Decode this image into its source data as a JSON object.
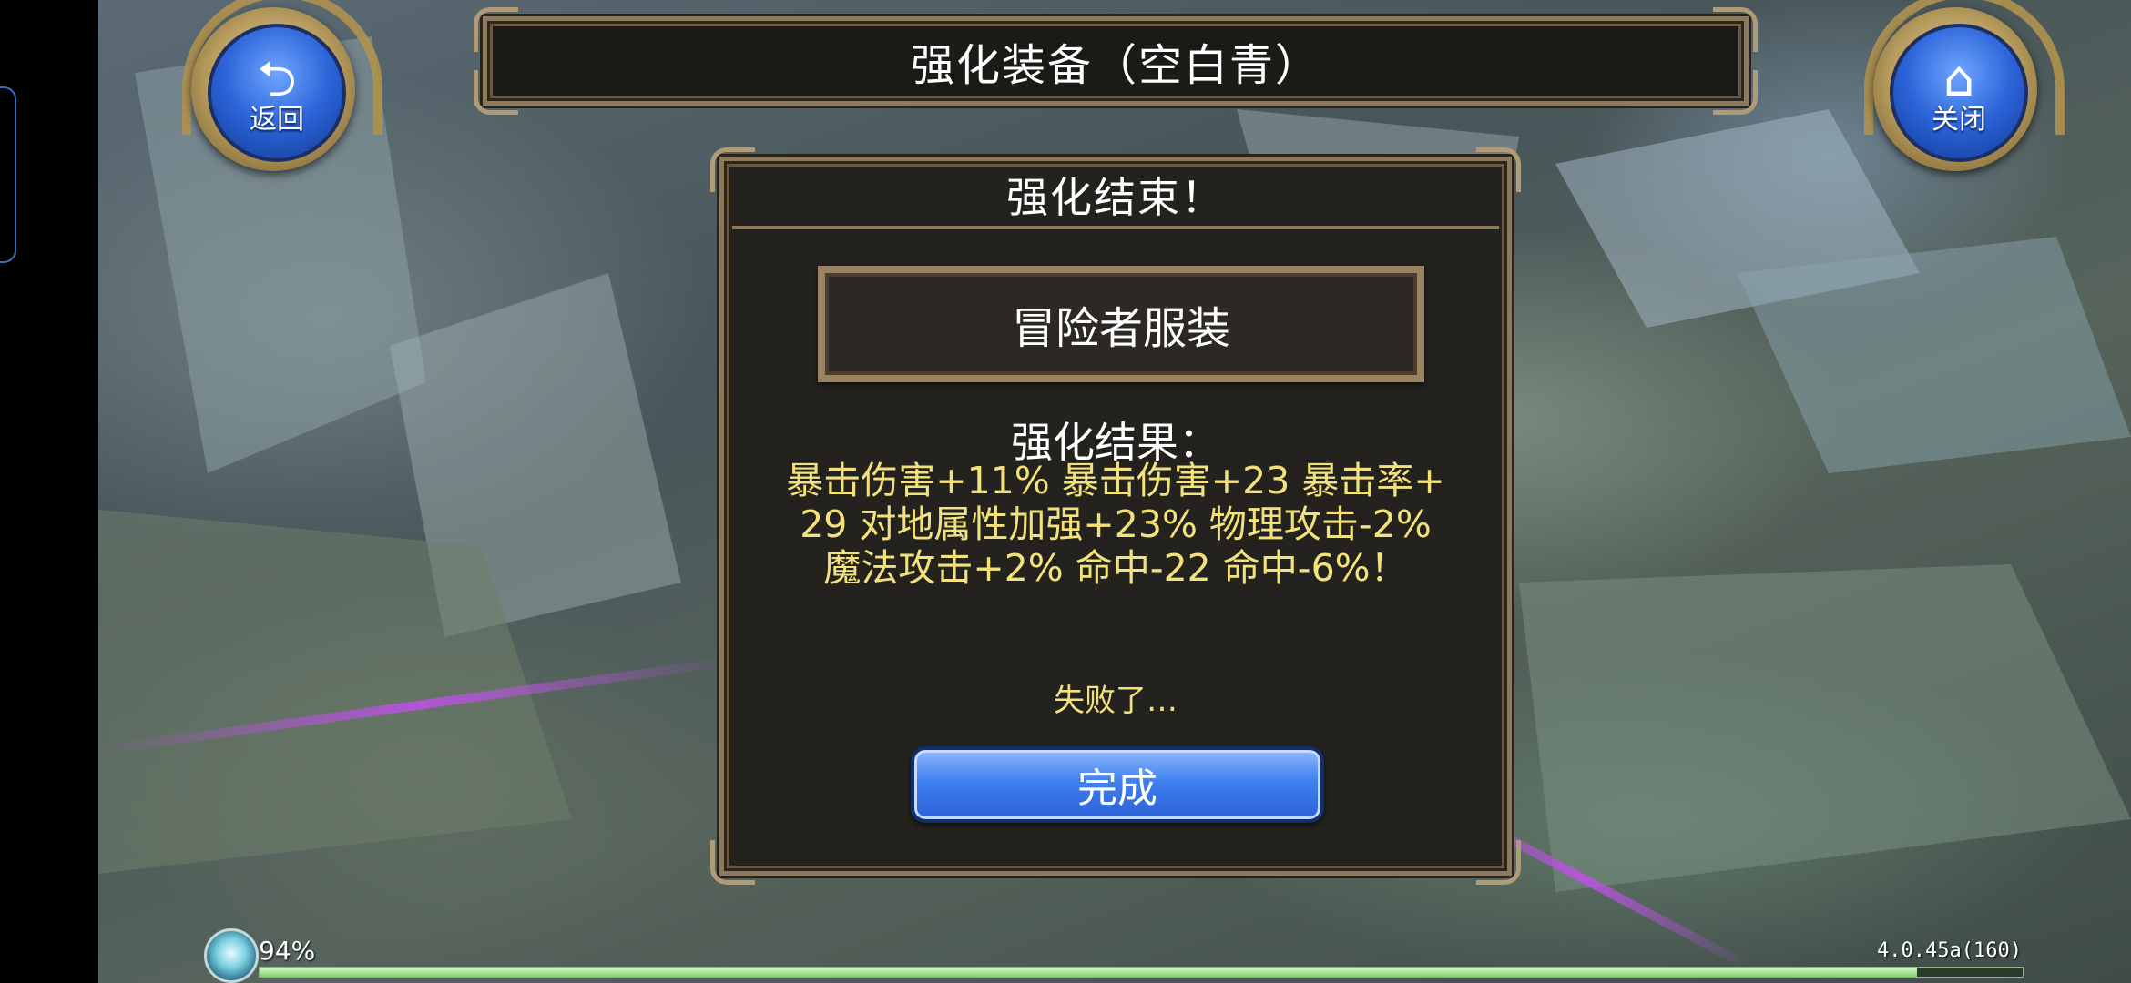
{
  "title": "强化装备（空白青）",
  "nav": {
    "back_label": "返回",
    "close_label": "关闭",
    "back_icon": "return-arrow-icon",
    "close_icon": "home-icon"
  },
  "dialog": {
    "header": "强化结束！",
    "item_name": "冒险者服装",
    "result_heading": "强化结果：",
    "result_lines": [
      "暴击伤害+11% 暴击伤害+23 暴击率+",
      "29 对地属性加强+23% 物理攻击-2%",
      "魔法攻击+2% 命中-22 命中-6%！"
    ],
    "status_text": "失败了…",
    "done_label": "完成"
  },
  "hud": {
    "percent": "94%",
    "progress": 0.94,
    "version": "4.0.45a(160)"
  },
  "colors": {
    "result_text": "#f3e27c",
    "button_blue": "#3f7ff0",
    "frame_gold": "#8d7a5c"
  }
}
